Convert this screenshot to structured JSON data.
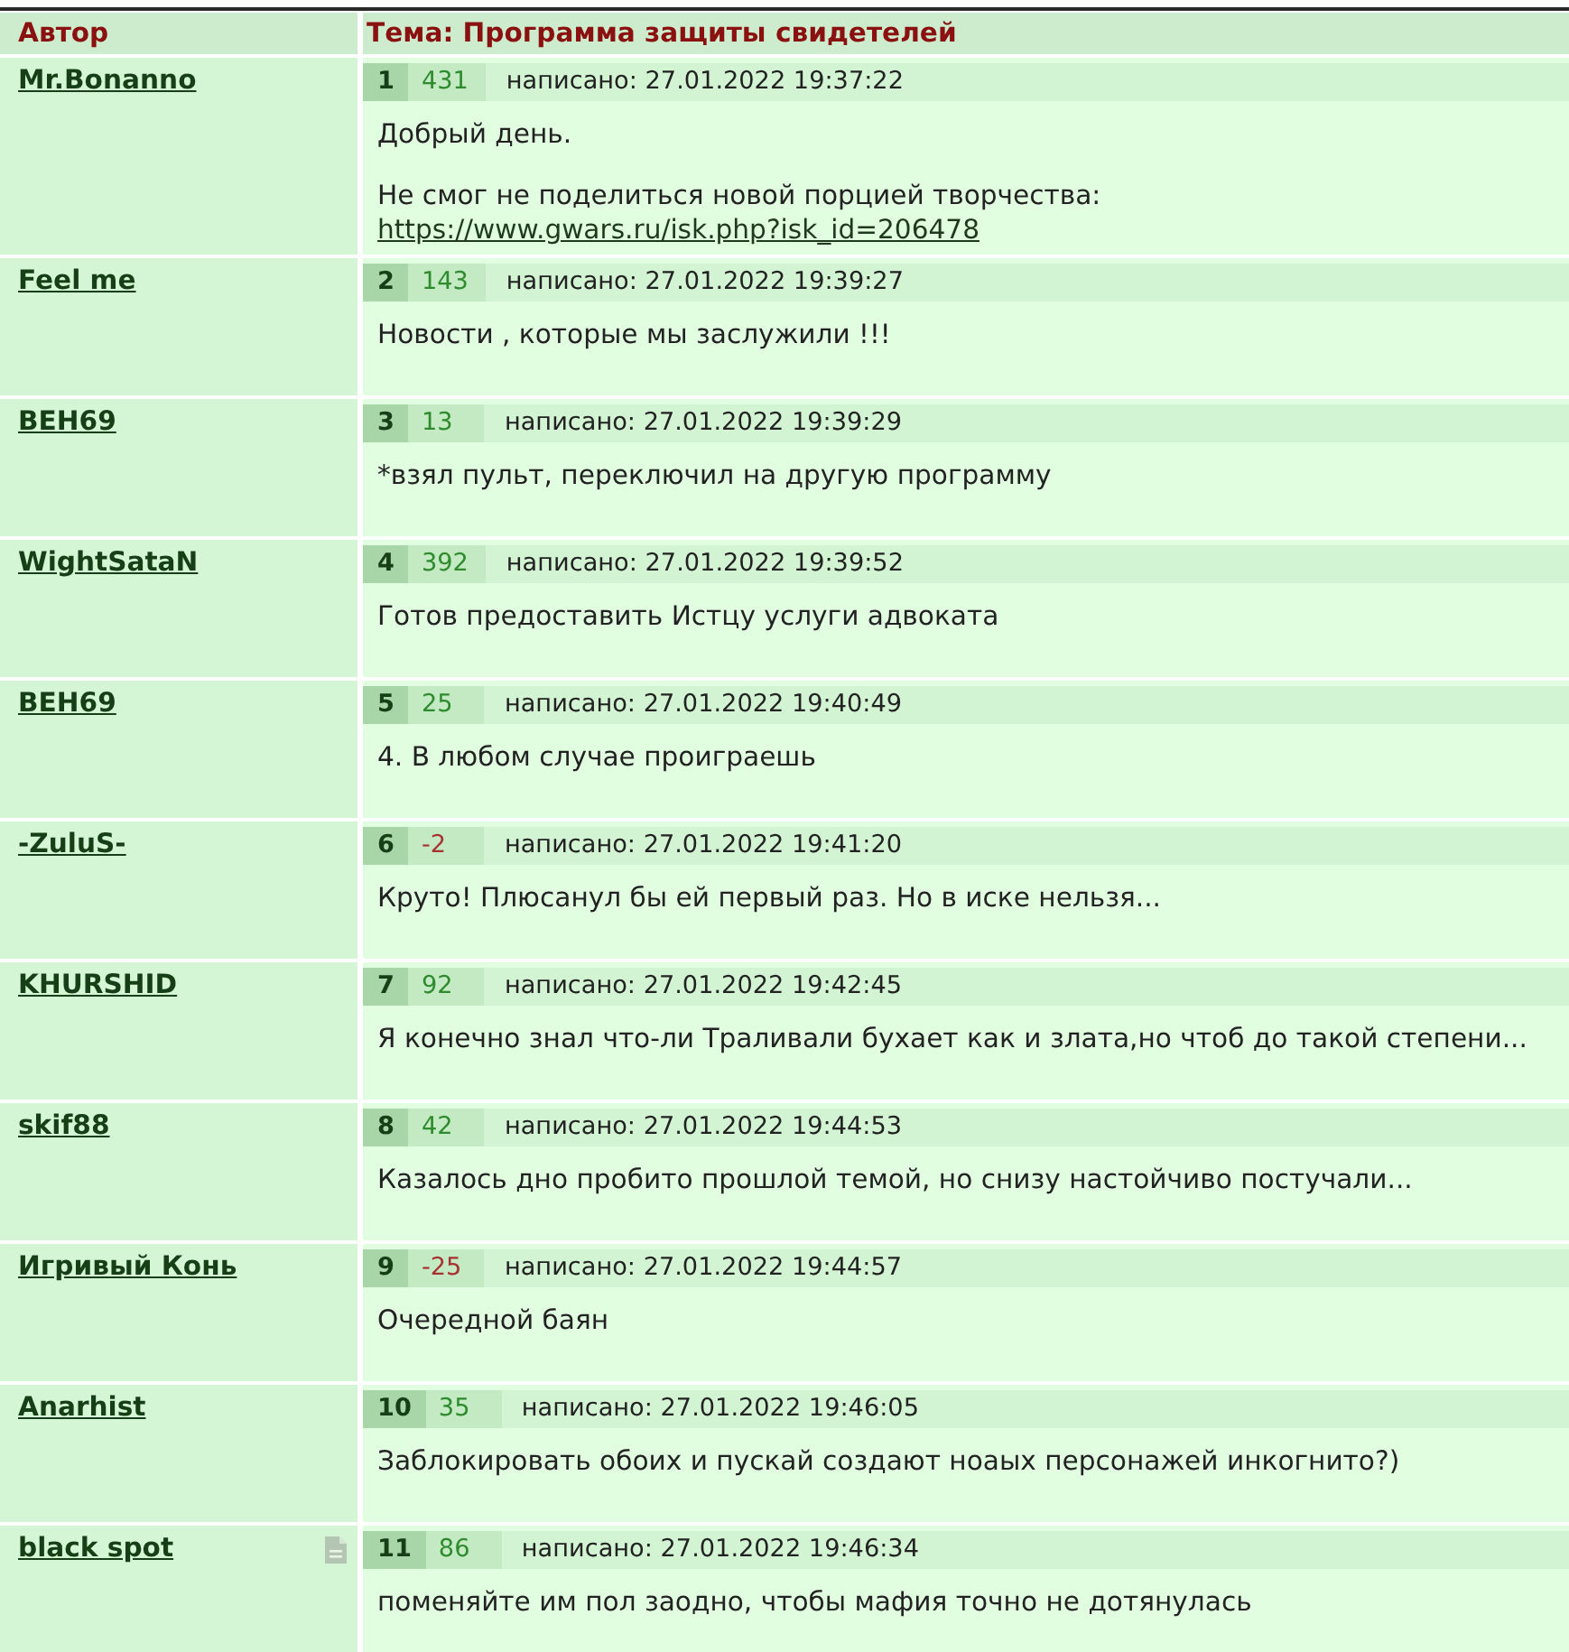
{
  "table": {
    "columns": [
      {
        "label": "Автор"
      },
      {
        "label": "Тема: Программа защиты свидетелей"
      }
    ]
  },
  "posts": [
    {
      "author": "Mr.Bonanno",
      "note_icon": false,
      "number": "1",
      "score": {
        "text": "431",
        "color": "#2e8b2e"
      },
      "posted": "написано: 27.01.2022 19:37:22",
      "body": [
        [
          {
            "kind": "text",
            "text": "Добрый день."
          }
        ],
        [
          {
            "kind": "text",
            "text": "Не смог не поделиться новой порцией творчества:"
          },
          {
            "kind": "link",
            "text": "https://www.gwars.ru/isk.php?isk_id=206478"
          }
        ]
      ]
    },
    {
      "author": "Feel me",
      "note_icon": false,
      "number": "2",
      "score": {
        "text": "143",
        "color": "#2e8b2e"
      },
      "posted": "написано: 27.01.2022 19:39:27",
      "body": [
        [
          {
            "kind": "text",
            "text": "Новости , которые мы заслужили !!!"
          }
        ]
      ]
    },
    {
      "author": "BEH69",
      "note_icon": false,
      "number": "3",
      "score": {
        "text": "13",
        "color": "#2e8b2e"
      },
      "posted": "написано: 27.01.2022 19:39:29",
      "body": [
        [
          {
            "kind": "text",
            "text": "*взял пульт, переключил на другую программу"
          }
        ]
      ]
    },
    {
      "author": "WightSataN",
      "note_icon": false,
      "number": "4",
      "score": {
        "text": "392",
        "color": "#2e8b2e"
      },
      "posted": "написано: 27.01.2022 19:39:52",
      "body": [
        [
          {
            "kind": "text",
            "text": "Готов предоставить Истцу услуги адвоката"
          }
        ]
      ]
    },
    {
      "author": "BEH69",
      "note_icon": false,
      "number": "5",
      "score": {
        "text": "25",
        "color": "#2e8b2e"
      },
      "posted": "написано: 27.01.2022 19:40:49",
      "body": [
        [
          {
            "kind": "text",
            "text": "4. В любом случае проиграешь"
          }
        ]
      ]
    },
    {
      "author": "-ZuluS-",
      "note_icon": false,
      "number": "6",
      "score": {
        "text": "-2",
        "color": "#a83232"
      },
      "posted": "написано: 27.01.2022 19:41:20",
      "body": [
        [
          {
            "kind": "text",
            "text": "Круто! Плюсанул бы ей первый раз. Но в иске нельзя..."
          }
        ]
      ]
    },
    {
      "author": "KHURSHID",
      "note_icon": false,
      "number": "7",
      "score": {
        "text": "92",
        "color": "#2e8b2e"
      },
      "posted": "написано: 27.01.2022 19:42:45",
      "body": [
        [
          {
            "kind": "text",
            "text": "Я конечно знал что-ли Траливали бухает как и злата,но чтоб до такой степени..."
          }
        ]
      ]
    },
    {
      "author": "skif88",
      "note_icon": false,
      "number": "8",
      "score": {
        "text": "42",
        "color": "#2e8b2e"
      },
      "posted": "написано: 27.01.2022 19:44:53",
      "body": [
        [
          {
            "kind": "text",
            "text": "Казалось дно пробито прошлой темой, но снизу настойчиво постучали..."
          }
        ]
      ]
    },
    {
      "author": "Игривый Конь",
      "note_icon": false,
      "number": "9",
      "score": {
        "text": "-25",
        "color": "#a83232"
      },
      "posted": "написано: 27.01.2022 19:44:57",
      "body": [
        [
          {
            "kind": "text",
            "text": "Очередной баян"
          }
        ]
      ]
    },
    {
      "author": "Anarhist",
      "note_icon": false,
      "number": "10",
      "score": {
        "text": "35",
        "color": "#2e8b2e"
      },
      "posted": "написано: 27.01.2022 19:46:05",
      "body": [
        [
          {
            "kind": "text",
            "text": "Заблокировать обоих и пускай создают ноаых персонажей инкогнито?)"
          }
        ]
      ]
    },
    {
      "author": "black spot",
      "note_icon": true,
      "number": "11",
      "score": {
        "text": "86",
        "color": "#2e8b2e"
      },
      "posted": "написано: 27.01.2022 19:46:34",
      "body": [
        [
          {
            "kind": "text",
            "text": "поменяйте им пол заодно, чтобы мафия точно не дотянулась"
          }
        ]
      ]
    }
  ]
}
